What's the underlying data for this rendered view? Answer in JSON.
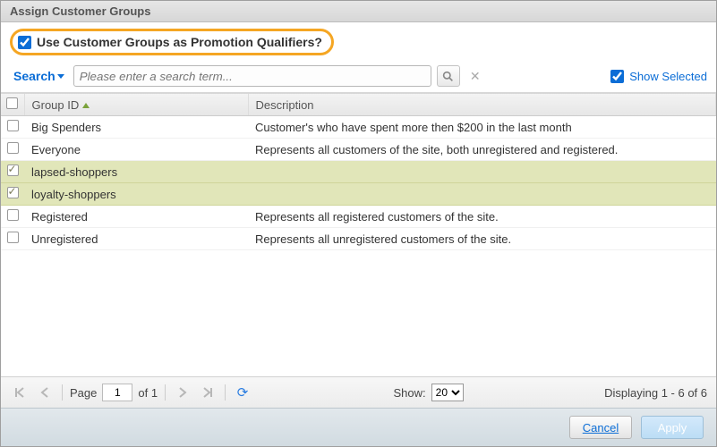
{
  "title": "Assign Customer Groups",
  "qualifier": {
    "checked": true,
    "label": "Use Customer Groups as Promotion Qualifiers?"
  },
  "search": {
    "label": "Search",
    "placeholder": "Please enter a search term..."
  },
  "show_selected": {
    "checked": true,
    "label": "Show Selected"
  },
  "columns": {
    "group_id": "Group ID",
    "description": "Description"
  },
  "rows": [
    {
      "selected": false,
      "group_id": "Big Spenders",
      "description": "Customer's who have spent more then $200 in the last month"
    },
    {
      "selected": false,
      "group_id": "Everyone",
      "description": "Represents all customers of the site, both unregistered and registered."
    },
    {
      "selected": true,
      "group_id": "lapsed-shoppers",
      "description": ""
    },
    {
      "selected": true,
      "group_id": "loyalty-shoppers",
      "description": ""
    },
    {
      "selected": false,
      "group_id": "Registered",
      "description": "Represents all registered customers of the site."
    },
    {
      "selected": false,
      "group_id": "Unregistered",
      "description": "Represents all unregistered customers of the site."
    }
  ],
  "pager": {
    "page_label": "Page",
    "page": "1",
    "of_label": "of 1",
    "show_label": "Show:",
    "page_size": "20",
    "displaying": "Displaying 1 - 6 of 6"
  },
  "buttons": {
    "cancel": "Cancel",
    "apply": "Apply"
  }
}
